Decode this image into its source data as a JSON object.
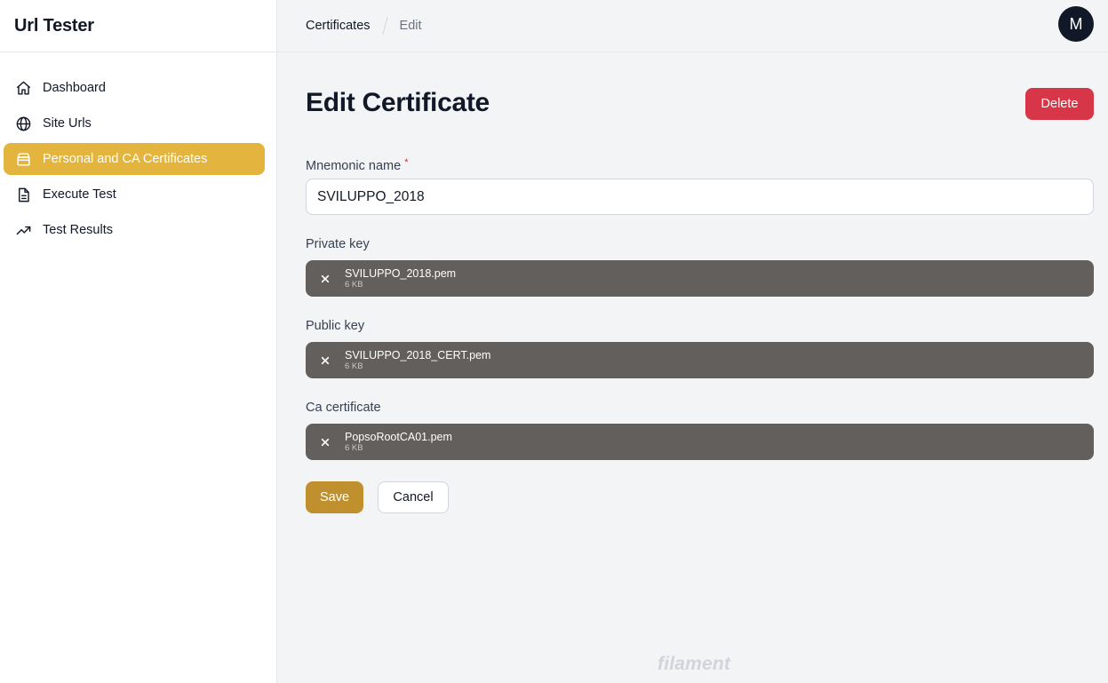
{
  "app": {
    "title": "Url Tester"
  },
  "sidebar": {
    "items": [
      {
        "label": "Dashboard",
        "icon": "home-icon"
      },
      {
        "label": "Site Urls",
        "icon": "globe-icon"
      },
      {
        "label": "Personal and CA Certificates",
        "icon": "archive-icon",
        "active": true
      },
      {
        "label": "Execute Test",
        "icon": "document-icon"
      },
      {
        "label": "Test Results",
        "icon": "trending-up-icon"
      }
    ]
  },
  "breadcrumb": {
    "items": [
      "Certificates",
      "Edit"
    ]
  },
  "user": {
    "avatar_initial": "M"
  },
  "page": {
    "title": "Edit Certificate",
    "delete_label": "Delete"
  },
  "form": {
    "mnemonic": {
      "label": "Mnemonic name",
      "required_mark": "*",
      "value": "SVILUPPO_2018"
    },
    "private_key": {
      "label": "Private key",
      "file_name": "SVILUPPO_2018.pem",
      "file_size": "6 KB"
    },
    "public_key": {
      "label": "Public key",
      "file_name": "SVILUPPO_2018_CERT.pem",
      "file_size": "6 KB"
    },
    "ca_certificate": {
      "label": "Ca certificate",
      "file_name": "PopsoRootCA01.pem",
      "file_size": "6 KB"
    },
    "save_label": "Save",
    "cancel_label": "Cancel"
  },
  "footer": {
    "brand": "filament"
  },
  "colors": {
    "accent": "#e3b53e",
    "save": "#c0902f",
    "danger": "#d63647",
    "file_bg": "#635f5c"
  }
}
